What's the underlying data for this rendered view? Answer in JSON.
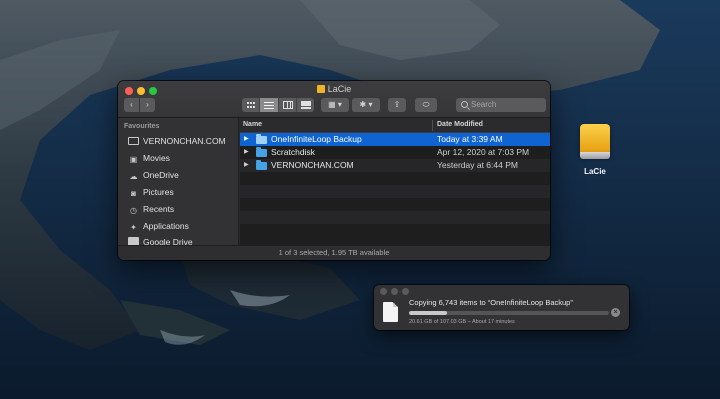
{
  "finder": {
    "title": "LaCie",
    "toolbar": {
      "back_icon": "chevron-left-icon",
      "forward_icon": "chevron-right-icon",
      "views": [
        "icon-view",
        "list-view",
        "column-view",
        "gallery-view"
      ],
      "active_view": "list-view",
      "search_placeholder": "Search"
    },
    "sidebar": {
      "heading": "Favourites",
      "items": [
        {
          "label": "VERNONCHAN.COM",
          "icon": "hard-drive-icon"
        },
        {
          "label": "Movies",
          "icon": "movies-icon"
        },
        {
          "label": "OneDrive",
          "icon": "cloud-icon"
        },
        {
          "label": "Pictures",
          "icon": "camera-icon"
        },
        {
          "label": "Recents",
          "icon": "clock-icon"
        },
        {
          "label": "Applications",
          "icon": "applications-icon"
        },
        {
          "label": "Google Drive",
          "icon": "folder-icon"
        }
      ]
    },
    "columns": {
      "name": "Name",
      "date": "Date Modified"
    },
    "files": [
      {
        "name": "OneInfiniteLoop Backup",
        "date": "Today at 3:39 AM",
        "selected": true
      },
      {
        "name": "Scratchdisk",
        "date": "Apr 12, 2020 at 7:03 PM",
        "selected": false
      },
      {
        "name": "VERNONCHAN.COM",
        "date": "Yesterday at 6:44 PM",
        "selected": false
      }
    ],
    "status": "1 of 3 selected, 1.95 TB available"
  },
  "desktop": {
    "drive_label": "LaCie",
    "drive_color": "#f0b429"
  },
  "copy_dialog": {
    "title": "Copying 6,743 items to “OneInfiniteLoop Backup”",
    "progress_fraction": 0.19,
    "detail": "20.61 GB of 107.03 GB – About 17 minutes"
  },
  "colors": {
    "selection": "#0f64d2",
    "folder": "#45a3e5"
  }
}
